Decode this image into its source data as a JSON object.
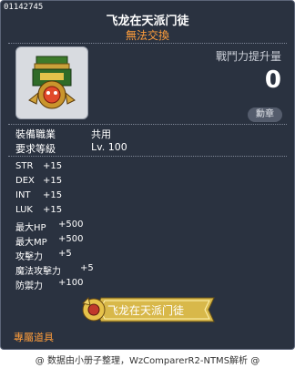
{
  "item": {
    "id": "01142745",
    "name": "飞龙在天派门徒",
    "trade_status": "無法交換"
  },
  "power": {
    "label": "戰鬥力提升量",
    "value": "0",
    "medal_button": "勳章"
  },
  "requirements": [
    {
      "label": "裝備職業",
      "value": "共用"
    },
    {
      "label": "要求等級",
      "value": "Lv. 100"
    }
  ],
  "stats": [
    {
      "label": "STR",
      "value": "+15"
    },
    {
      "label": "DEX",
      "value": "+15"
    },
    {
      "label": "INT",
      "value": "+15"
    },
    {
      "label": "LUK",
      "value": "+15"
    },
    {
      "label": "最大HP",
      "value": "+500"
    },
    {
      "label": "最大MP",
      "value": "+500"
    },
    {
      "label": "攻擊力",
      "value": "+5"
    },
    {
      "label": "魔法攻擊力",
      "value": "+5"
    },
    {
      "label": "防禦力",
      "value": "+100"
    }
  ],
  "set_label": "飞龙在天派门徒",
  "special_item": "專屬道具",
  "footer": "@ 数据由小册子整理，WzComparerR2-NTMS解析 @",
  "colors": {
    "panel_bg": "#2a3240",
    "accent_orange": "#ff9d3b",
    "badge_gold": "#d8b84a"
  }
}
